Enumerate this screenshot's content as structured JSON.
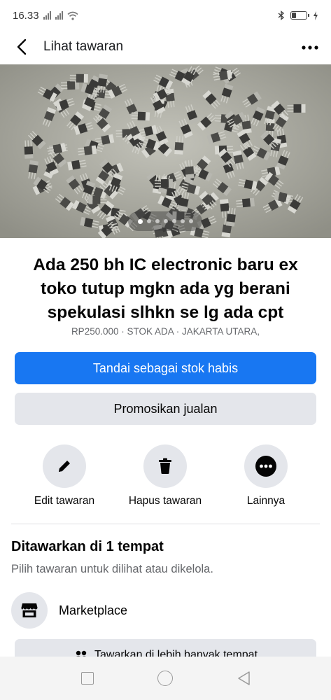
{
  "status_bar": {
    "time": "16.33",
    "battery_level": 0.3
  },
  "header": {
    "title": "Lihat tawaran",
    "more_icon": "more-horizontal-icon",
    "back_icon": "chevron-left-icon"
  },
  "listing": {
    "photo_count": 7,
    "active_photo": 1,
    "title": "Ada 250 bh IC electronic baru ex toko tutup mgkn ada yg berani spekulasi slhkn se lg ada cpt",
    "meta": "RP250.000 · STOK ADA · JAKARTA UTARA,"
  },
  "buttons": {
    "mark_sold": "Tandai sebagai stok habis",
    "promote": "Promosikan jualan"
  },
  "actions": [
    {
      "label": "Edit tawaran",
      "icon": "pencil-icon"
    },
    {
      "label": "Hapus tawaran",
      "icon": "trash-icon"
    },
    {
      "label": "Lainnya",
      "icon": "more-circle-icon"
    }
  ],
  "offered_section": {
    "title": "Ditawarkan di 1 tempat",
    "subtitle": "Pilih tawaran untuk dilihat atau dikelola.",
    "places": [
      {
        "label": "Marketplace",
        "icon": "storefront-icon"
      }
    ],
    "more_button": "Tawarkan di lebih banyak tempat"
  },
  "colors": {
    "primary": "#1877f2",
    "secondary_button": "#e4e6eb",
    "muted_text": "#65676b"
  }
}
